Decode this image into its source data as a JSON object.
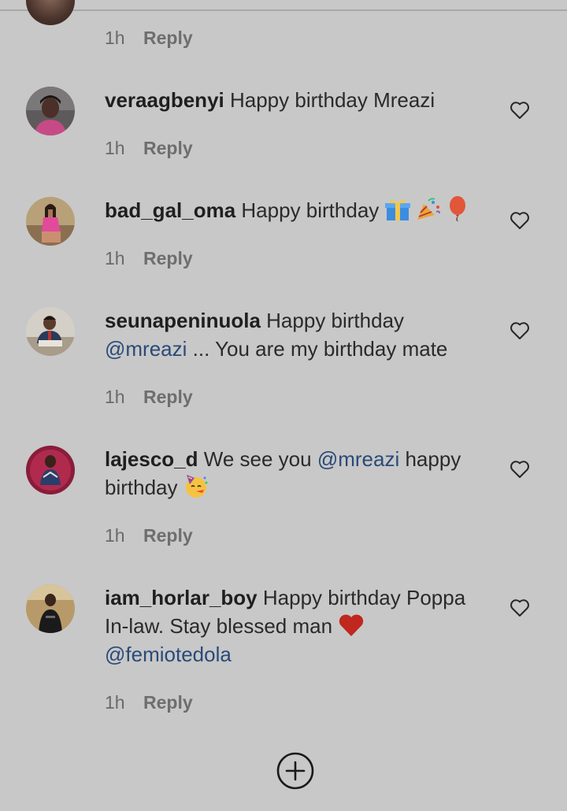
{
  "reply_label": "Reply",
  "top": {
    "time": "1h"
  },
  "comments": [
    {
      "username": "veraagbenyi",
      "text": "Happy birthday Mreazi",
      "time": "1h"
    },
    {
      "username": "bad_gal_oma",
      "text": "Happy birthday",
      "emojis": [
        "gift-emoji",
        "party-popper-emoji",
        "balloon-emoji"
      ],
      "time": "1h"
    },
    {
      "username": "seunapeninuola",
      "text_before": "Happy birthday",
      "mention": "@mreazi",
      "text_after": "... You are my birthday mate",
      "time": "1h"
    },
    {
      "username": "lajesco_d",
      "text_before": "We see you",
      "mention": "@mreazi",
      "text_after": "happy birthday",
      "emojis": [
        "partying-face-emoji"
      ],
      "time": "1h"
    },
    {
      "username": "iam_horlar_boy",
      "text_before": "Happy birthday Poppa In-law. Stay blessed man",
      "emojis": [
        "red-heart-emoji"
      ],
      "mention": "@femiotedola",
      "time": "1h"
    }
  ],
  "colors": {
    "background": "#c8c8c8",
    "mention": "#2a4a78",
    "meta": "#6e6e6e"
  },
  "icons": {
    "like": "heart-outline-icon",
    "add": "plus-circle-icon"
  }
}
